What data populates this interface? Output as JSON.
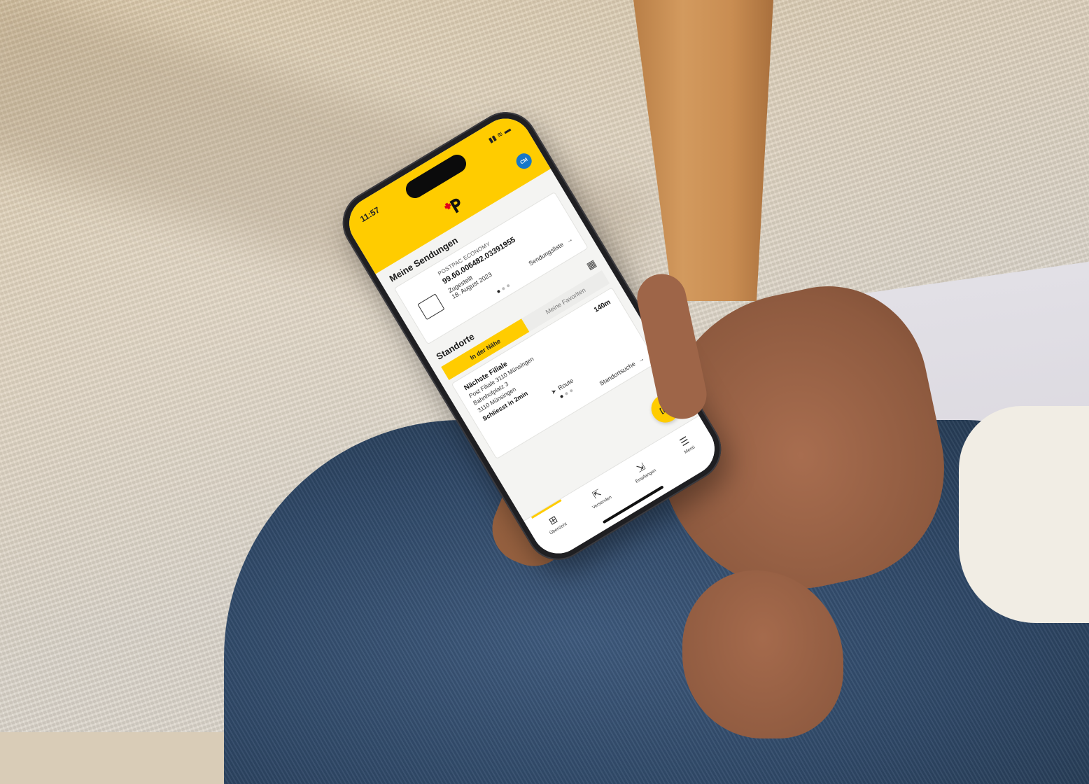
{
  "phone": {
    "status_time": "11:57",
    "status_icons": "▮▮ ≋ ▬",
    "avatar_initials": "CM",
    "shipments": {
      "title": "Meine Sendungen",
      "type": "POSTPAC ECONOMY",
      "tracking_number": "99.60.006482.03391955",
      "status": "Zugestellt",
      "date": "18. August 2023",
      "list_link": "Sendungsliste"
    },
    "locations": {
      "title": "Standorte",
      "tabs": [
        "In der Nähe",
        "Meine Favoriten"
      ],
      "branch_label": "Nächste Filiale",
      "distance": "140m",
      "branch_name": "Post Filiale 3110 Münsingen",
      "street": "Bahnhofplatz 3",
      "city": "3110 Münsingen",
      "closing": "Schliesst in 2min",
      "route": "Route",
      "search_link": "Standortsuche"
    },
    "tabbar": [
      {
        "label": "Übersicht",
        "icon": "grid-icon"
      },
      {
        "label": "Versenden",
        "icon": "send-icon"
      },
      {
        "label": "Empfangen",
        "icon": "receive-icon"
      },
      {
        "label": "Menü",
        "icon": "menu-icon"
      }
    ],
    "colors": {
      "brand_yellow": "#ffcc00",
      "avatar_blue": "#1677c9"
    }
  }
}
